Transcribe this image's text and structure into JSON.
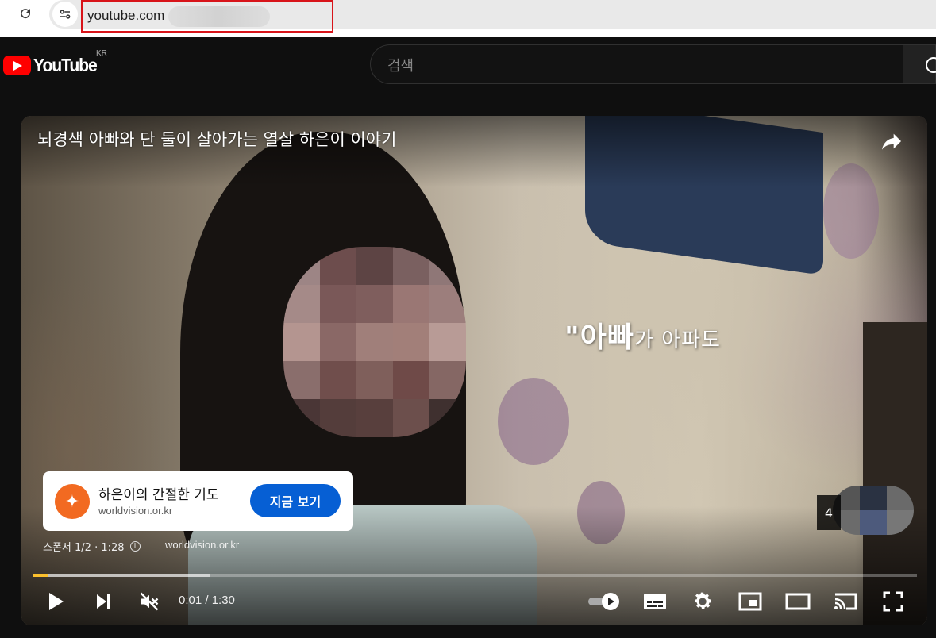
{
  "browser": {
    "url": "youtube.com"
  },
  "header": {
    "logo_text": "YouTube",
    "region": "KR",
    "search_placeholder": "검색"
  },
  "player": {
    "title": "뇌경색 아빠와 단 둘이 살아가는 열살 하은이 이야기",
    "subtitle_quote": "\"",
    "subtitle_main": "아빠",
    "subtitle_rest": "가 아파도",
    "ad": {
      "title": "하은이의 간절한 기도",
      "url": "worldvision.or.kr",
      "cta": "지금 보기",
      "sponsor_text": "스폰서 1/2 · 1:28",
      "sponsor_url": "worldvision.or.kr"
    },
    "skip_countdown": "4",
    "time_display": "0:01 / 1:30",
    "progress_played": 0.017,
    "progress_buffered": 0.2,
    "accent_color": "#fbc02d",
    "cta_color": "#065fd4"
  },
  "icons": {
    "reload": "reload-icon",
    "site_info": "tune-icon",
    "share": "share-icon",
    "play": "play-icon",
    "next": "next-icon",
    "mute": "volume-muted-icon",
    "autoplay": "autoplay-toggle-icon",
    "subtitles": "subtitles-icon",
    "settings": "gear-icon",
    "miniplayer": "miniplayer-icon",
    "theater": "theater-icon",
    "cast": "cast-icon",
    "fullscreen": "fullscreen-icon"
  }
}
